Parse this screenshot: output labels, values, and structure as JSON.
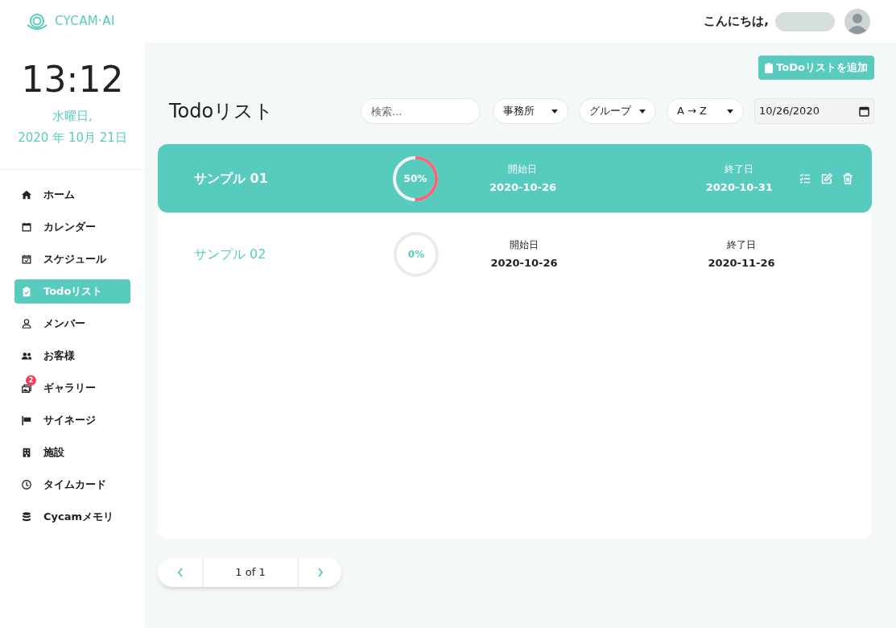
{
  "header": {
    "logo": "CYCAM·AI",
    "greeting": "こんにちは,"
  },
  "clock": {
    "time": "13:12",
    "weekday": "水曜日,",
    "date": "2020 年 10月 21日"
  },
  "sidebar": {
    "items": [
      {
        "label": "ホーム",
        "kind": "home",
        "selected": false
      },
      {
        "label": "カレンダー",
        "kind": "calendar",
        "selected": false
      },
      {
        "label": "スケジュール",
        "kind": "schedule",
        "selected": false
      },
      {
        "label": "Todoリスト",
        "kind": "todo",
        "selected": true
      },
      {
        "label": "メンバー",
        "kind": "member",
        "selected": false
      },
      {
        "label": "お客様",
        "kind": "customer",
        "selected": false
      },
      {
        "label": "ギャラリー",
        "kind": "gallery",
        "selected": false,
        "badge": "2"
      },
      {
        "label": "サイネージ",
        "kind": "signage",
        "selected": false
      },
      {
        "label": "施設",
        "kind": "facility",
        "selected": false
      },
      {
        "label": "タイムカード",
        "kind": "timecard",
        "selected": false
      },
      {
        "label": "Cycamメモリ",
        "kind": "memory",
        "selected": false
      }
    ]
  },
  "add_button": "ToDoリストを追加",
  "title": "Todoリスト",
  "filters": {
    "search": {
      "placeholder": "検索..."
    },
    "dropdowns": [
      "事務所",
      "グループ",
      "A → Z"
    ],
    "date": "10/26/2020"
  },
  "rows": [
    {
      "name": "サンプル 01",
      "level": 0.5,
      "percent": "50%",
      "start_label": "開始日",
      "start": "2020-10-26",
      "end_label": "終了日",
      "end": "2020-10-31",
      "selected": true
    },
    {
      "name": "サンプル 02",
      "level": 0,
      "percent": "0%",
      "start_label": "開始日",
      "start": "2020-10-26",
      "end_label": "終了日",
      "end": "2020-11-26",
      "selected": false
    }
  ],
  "pagination": {
    "label": "1 of 1"
  }
}
